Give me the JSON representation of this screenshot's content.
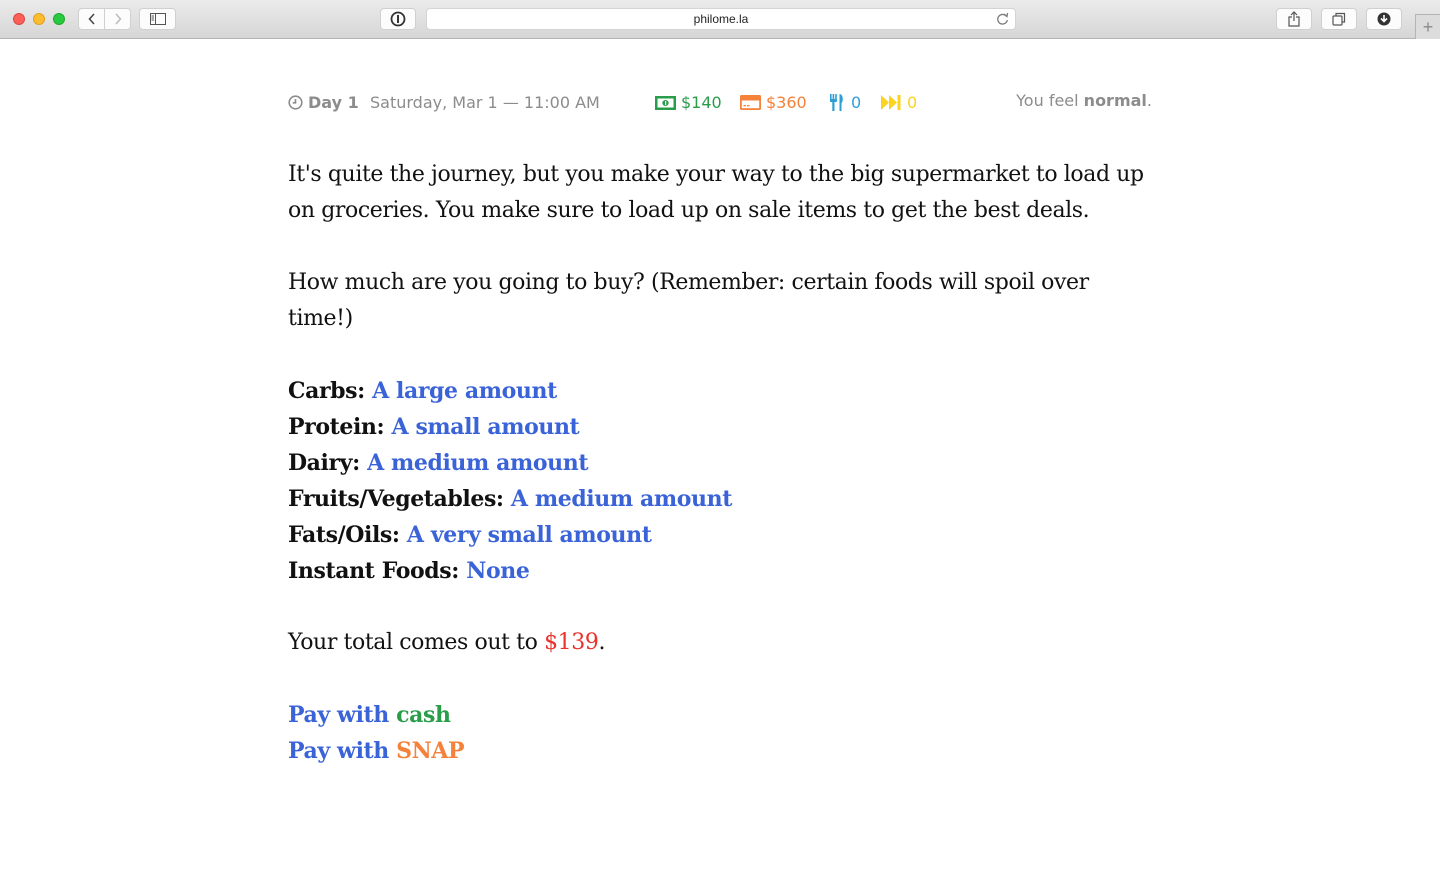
{
  "browser": {
    "url": "philome.la",
    "new_tab_label": "+"
  },
  "status": {
    "day_label": "Day 1",
    "datetime": "Saturday, Mar 1 — 11:00 AM",
    "cash": "$140",
    "snap": "$360",
    "meals": "0",
    "skips": "0",
    "feel_prefix": "You feel ",
    "feel_state": "normal",
    "feel_suffix": ".",
    "colors": {
      "cash": "#2a9d4b",
      "snap": "#f4823b",
      "meals": "#2e9fd5",
      "skips": "#fcd31e"
    }
  },
  "story": {
    "intro": "It's quite the journey, but you make your way to the big supermarket to load up on groceries. You make sure to load up on sale items to get the best deals.",
    "question": "How much are you going to buy? (Remember: certain foods will spoil over time!)",
    "categories": [
      {
        "label": "Carbs:",
        "value": "A large amount"
      },
      {
        "label": "Protein:",
        "value": "A small amount"
      },
      {
        "label": "Dairy:",
        "value": "A medium amount"
      },
      {
        "label": "Fruits/Vegetables:",
        "value": "A medium amount"
      },
      {
        "label": "Fats/Oils:",
        "value": "A very small amount"
      },
      {
        "label": "Instant Foods:",
        "value": "None"
      }
    ],
    "total_prefix": "Your total comes out to ",
    "total_amount": "$139",
    "total_suffix": ".",
    "pay_options": [
      {
        "prefix": "Pay with ",
        "method": "cash"
      },
      {
        "prefix": "Pay with ",
        "method": "SNAP"
      }
    ]
  }
}
